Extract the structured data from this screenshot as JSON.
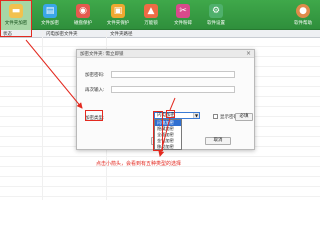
{
  "toolbar": {
    "items": [
      {
        "label": "文件夹加密",
        "icon": "folder-lock-icon",
        "color": "#f2c14e",
        "active": true
      },
      {
        "label": "文件加密",
        "icon": "file-lock-icon",
        "color": "#3aa6e8"
      },
      {
        "label": "磁盘保护",
        "icon": "disk-protect-icon",
        "color": "#e65a4f"
      },
      {
        "label": "文件夹保护",
        "icon": "folder-shield-icon",
        "color": "#f0a830"
      },
      {
        "label": "万能锁",
        "icon": "lock-icon",
        "color": "#ef6b45"
      },
      {
        "label": "文件粉碎",
        "icon": "shredder-icon",
        "color": "#d94a8c"
      },
      {
        "label": "软件设置",
        "icon": "settings-icon",
        "color": "#4fb06c"
      },
      {
        "label": "软件帮助",
        "icon": "help-avatar-icon",
        "color": "#e08b4a"
      }
    ]
  },
  "list": {
    "headers": [
      "状态",
      "闪电加密文件夹",
      "文件夹路径"
    ]
  },
  "dialog": {
    "title": "加密文件夹: 需立即锁",
    "close_glyph": "×",
    "password_label": "加密密码:",
    "confirm_label": "再次输入:",
    "type_label": "加密类型:",
    "combo_value": "闪电加密",
    "dropdown_options": [
      "闪电加密",
      "隐藏加密",
      "全面加密",
      "金钻加密",
      "移动加密"
    ],
    "selected_index": 0,
    "show_password_label": "显示密码",
    "confirm_button": "必填",
    "ok_button": "确定",
    "cancel_button": "取消"
  },
  "annotation": "点击小箭头，会看到有五种类型的选择"
}
